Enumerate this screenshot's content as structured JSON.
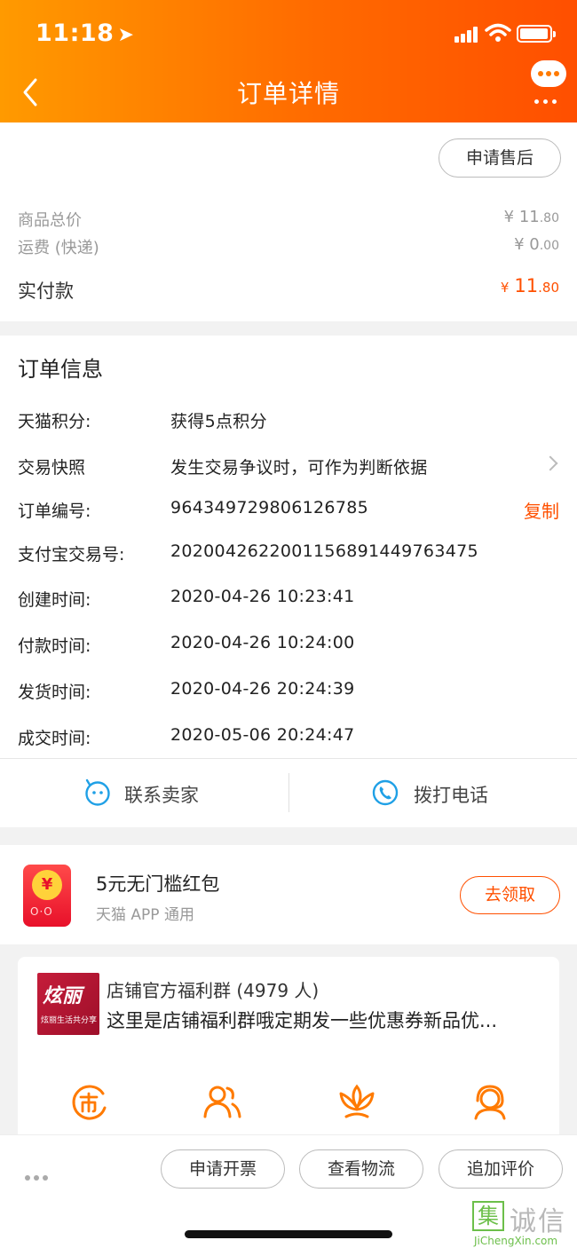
{
  "status_bar": {
    "time": "11:18"
  },
  "header": {
    "title": "订单详情"
  },
  "price": {
    "aftersale_label": "申请售后",
    "goods_total_label": "商品总价",
    "goods_total_int": "¥ 11",
    "goods_total_dec": ".80",
    "shipping_label": "运费 (快递)",
    "shipping_int": "¥ 0",
    "shipping_dec": ".00",
    "paid_label": "实付款",
    "paid_currency": "¥",
    "paid_int": "11",
    "paid_dec": ".80"
  },
  "order_info": {
    "title": "订单信息",
    "rows": [
      {
        "label": "天猫积分:",
        "value": "获得5点积分"
      },
      {
        "label": "交易快照",
        "value": "发生交易争议时，可作为判断依据"
      },
      {
        "label": "订单编号:",
        "value": "964349729806126785"
      },
      {
        "label": "支付宝交易号:",
        "value": "2020042622001156891449763475"
      },
      {
        "label": "创建时间:",
        "value": "2020-04-26 10:23:41"
      },
      {
        "label": "付款时间:",
        "value": "2020-04-26 10:24:00"
      },
      {
        "label": "发货时间:",
        "value": "2020-04-26 20:24:39"
      },
      {
        "label": "成交时间:",
        "value": "2020-05-06 20:24:47"
      }
    ],
    "copy_label": "复制",
    "contact_seller": "联系卖家",
    "call_phone": "拨打电话"
  },
  "coupon": {
    "title": "5元无门槛红包",
    "subtitle": "天猫 APP 通用",
    "claim_label": "去领取",
    "icon_coin": "¥",
    "icon_face": "O·O"
  },
  "group": {
    "logo_text": "炫丽",
    "logo_sub": "炫丽生活共分享",
    "name": "店铺官方福利群 (4979 人)",
    "desc": "这里是店铺福利群哦定期发一些优惠券新品优..."
  },
  "bottom": {
    "invoice": "申请开票",
    "logistics": "查看物流",
    "review": "追加评价"
  },
  "watermark": {
    "box": "集",
    "text": "诚信",
    "url": "JiChengXin.com"
  },
  "colors": {
    "accent": "#ff5000",
    "header_start": "#ff9a00",
    "header_end": "#ff4f00",
    "icon_orange": "#ff7a00",
    "icon_blue": "#1fa0e6"
  }
}
